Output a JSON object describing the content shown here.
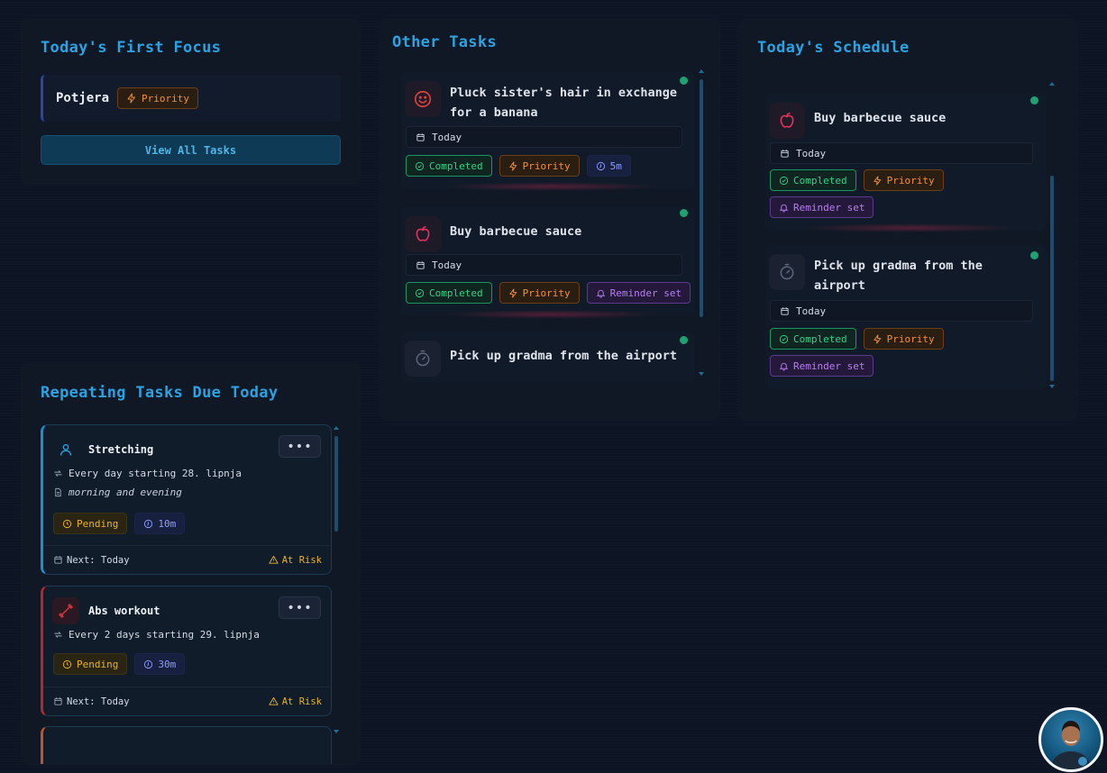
{
  "focus": {
    "title": "Today's First Focus",
    "task_name": "Potjera",
    "priority_label": "Priority",
    "view_all_label": "View All Tasks"
  },
  "other_tasks": {
    "title": "Other Tasks",
    "items": [
      {
        "title_line1": "Pluck sister's hair in exchange",
        "title_line2": "for a banana",
        "icon": "smile-icon",
        "date": "Today",
        "completed": "Completed",
        "priority": "Priority",
        "duration": "5m"
      },
      {
        "title": "Buy barbecue sauce",
        "icon": "apple-icon",
        "date": "Today",
        "completed": "Completed",
        "priority": "Priority",
        "reminder": "Reminder set"
      },
      {
        "title": "Pick up gradma from the airport",
        "icon": "stopwatch-icon"
      }
    ]
  },
  "schedule": {
    "title": "Today's Schedule",
    "items": [
      {
        "title": "Buy barbecue sauce",
        "icon": "apple-icon",
        "date": "Today",
        "completed": "Completed",
        "priority": "Priority",
        "reminder": "Reminder set"
      },
      {
        "title_line1": "Pick up gradma from the",
        "title_line2": "airport",
        "icon": "stopwatch-icon",
        "date": "Today",
        "completed": "Completed",
        "priority": "Priority",
        "reminder": "Reminder set"
      }
    ]
  },
  "repeating": {
    "title": "Repeating Tasks Due Today",
    "items": [
      {
        "name": "Stretching",
        "icon": "person-icon",
        "recurrence": "Every day starting 28. lipnja",
        "note": "morning and evening",
        "status": "Pending",
        "duration": "10m",
        "next": "Next: Today",
        "risk": "At Risk",
        "more": "•••"
      },
      {
        "name": "Abs workout",
        "icon": "dumbbell-icon",
        "recurrence": "Every 2 days starting 29. lipnja",
        "status": "Pending",
        "duration": "30m",
        "next": "Next: Today",
        "risk": "At Risk",
        "more": "•••"
      }
    ]
  },
  "colors": {
    "accent": "#2aa3e2",
    "completed": "#2ed388",
    "priority": "#f0913a",
    "reminder": "#b77ef0",
    "pending": "#e9b520",
    "time": "#8f9eff"
  }
}
